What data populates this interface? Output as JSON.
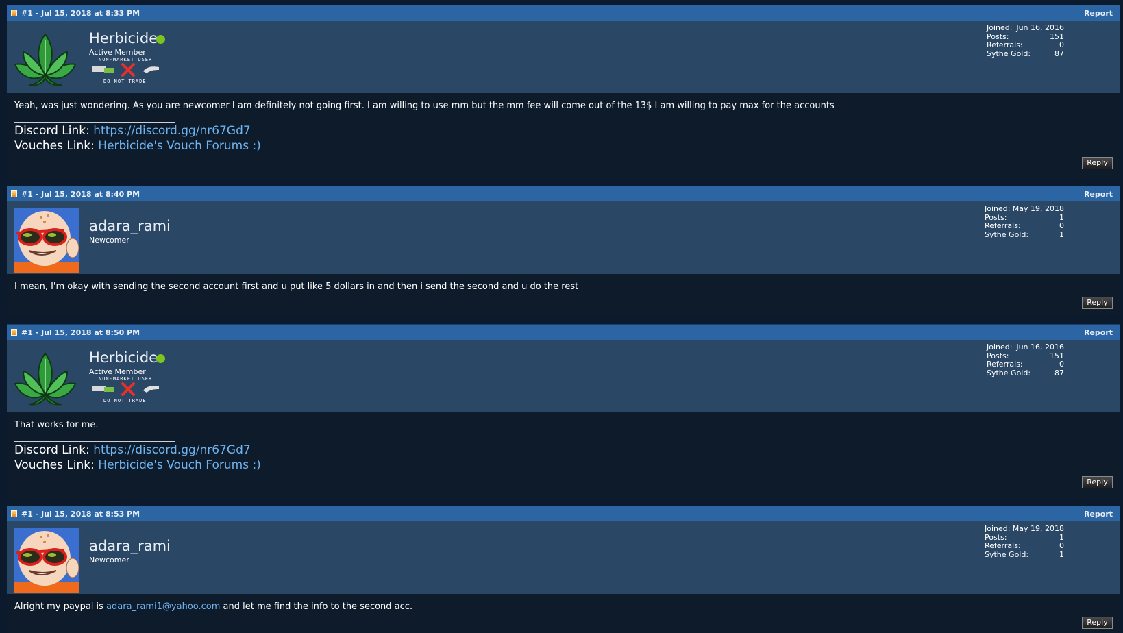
{
  "posts": [
    {
      "header": "#1 - Jul 15, 2018 at 8:33 PM",
      "report": "Report",
      "username": "Herbicide",
      "rank": "Active Member",
      "badge_top": "NON-MARKET USER",
      "badge_bottom": "DO NOT TRADE",
      "stats": {
        "joined_label": "Joined:",
        "joined": "Jun 16, 2016",
        "posts_label": "Posts:",
        "posts": "151",
        "referrals_label": "Referrals:",
        "referrals": "0",
        "gold_label": "Sythe Gold:",
        "gold": "87"
      },
      "message": "Yeah, was just wondering. As you are newcomer I am definitely not going first. I am willing to use mm but the mm fee will come out of the 13$ I am willing to pay max for the accounts",
      "sig": {
        "discord_label": "Discord Link:",
        "discord_url": "https://discord.gg/nr67Gd7",
        "vouches_label": "Vouches Link:",
        "vouches_text": "Herbicide's Vouch Forums :)"
      },
      "reply": "Reply"
    },
    {
      "header": "#1 - Jul 15, 2018 at 8:40 PM",
      "report": "Report",
      "username": "adara_rami",
      "rank": "Newcomer",
      "stats": {
        "joined_label": "Joined:",
        "joined": "May 19, 2018",
        "posts_label": "Posts:",
        "posts": "1",
        "referrals_label": "Referrals:",
        "referrals": "0",
        "gold_label": "Sythe Gold:",
        "gold": "1"
      },
      "message": "I mean, I'm okay with sending the second account first and u put like 5 dollars in and then i send the second and u do the rest",
      "reply": "Reply"
    },
    {
      "header": "#1 - Jul 15, 2018 at 8:50 PM",
      "report": "Report",
      "username": "Herbicide",
      "rank": "Active Member",
      "badge_top": "NON-MARKET USER",
      "badge_bottom": "DO NOT TRADE",
      "stats": {
        "joined_label": "Joined:",
        "joined": "Jun 16, 2016",
        "posts_label": "Posts:",
        "posts": "151",
        "referrals_label": "Referrals:",
        "referrals": "0",
        "gold_label": "Sythe Gold:",
        "gold": "87"
      },
      "message": "That works for me.",
      "sig": {
        "discord_label": "Discord Link:",
        "discord_url": "https://discord.gg/nr67Gd7",
        "vouches_label": "Vouches Link:",
        "vouches_text": "Herbicide's Vouch Forums :)"
      },
      "reply": "Reply"
    },
    {
      "header": "#1 - Jul 15, 2018 at 8:53 PM",
      "report": "Report",
      "username": "adara_rami",
      "rank": "Newcomer",
      "stats": {
        "joined_label": "Joined:",
        "joined": "May 19, 2018",
        "posts_label": "Posts:",
        "posts": "1",
        "referrals_label": "Referrals:",
        "referrals": "0",
        "gold_label": "Sythe Gold:",
        "gold": "1"
      },
      "message_pre": "Alright my paypal is ",
      "message_link": "adara_rami1@yahoo.com",
      "message_post": " and let me find the info to the second acc.",
      "reply": "Reply"
    }
  ]
}
